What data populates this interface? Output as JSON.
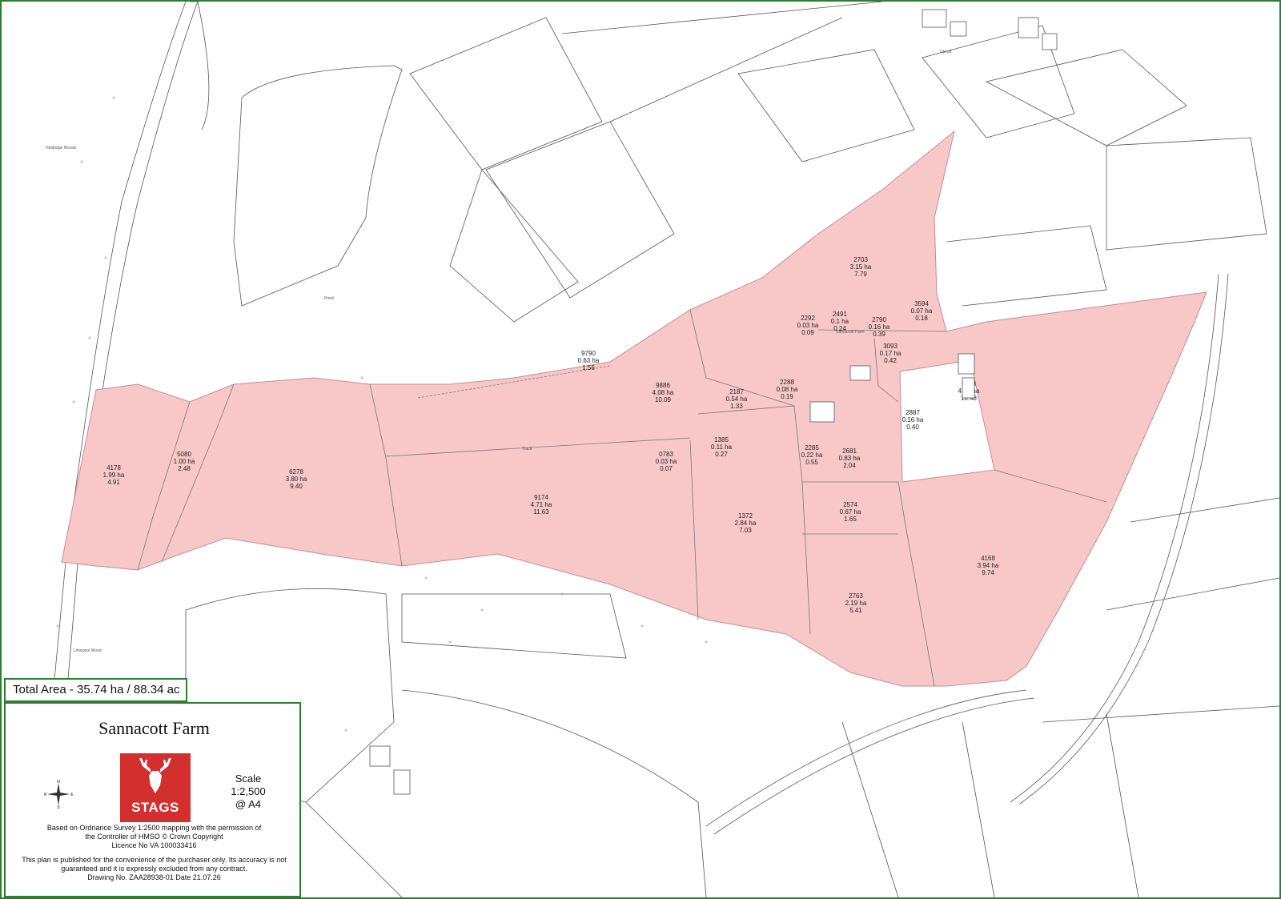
{
  "total_area": "Total Area - 35.74 ha / 88.34 ac",
  "legend": {
    "title": "Sannacott Farm",
    "logo_text": "STAGS",
    "scale": [
      "Scale",
      "1:2,500",
      "@ A4"
    ],
    "compass": {
      "n": "N",
      "s": "S",
      "e": "E",
      "w": "W"
    },
    "os_note": [
      "Based on Ordnance Survey 1:2500 mapping with the permission of",
      "the Controller of HMSO     © Crown Copyright",
      "Licence No VA 100033416"
    ],
    "disclaimer": [
      "This plan is published for the convenience of the purchaser only. Its accuracy is not",
      "guaranteed and it is expressly excluded from any contract.",
      "Drawing No. ZAA28938-01    Date 21.07.26"
    ]
  },
  "colors": {
    "parcel_fill": "#f8c8c8",
    "parcel_stroke": "#c98c8c",
    "frame": "#2e7d32",
    "logo": "#d32f2f"
  },
  "map_labels": {
    "holdridge_woods": "Holdridge Woods",
    "limepool_wood": "Limepool Wood",
    "sannacott_farm": "Sannacott Farm",
    "upcott": "Upcott",
    "pond": "Pond",
    "track": "Track"
  },
  "parcels": [
    {
      "id": "4178",
      "ha": "1.99 ha",
      "ac": "4.91"
    },
    {
      "id": "5080",
      "ha": "1.00 ha",
      "ac": "2.48"
    },
    {
      "id": "6278",
      "ha": "3.80 ha",
      "ac": "9.40"
    },
    {
      "id": "9174",
      "ha": "4.71 ha",
      "ac": "11.63"
    },
    {
      "id": "9790",
      "ha": "0.63 ha",
      "ac": "1.56"
    },
    {
      "id": "9886",
      "ha": "4.08 ha",
      "ac": "10.09"
    },
    {
      "id": "0783",
      "ha": "0.03 ha",
      "ac": "0.07"
    },
    {
      "id": "1385",
      "ha": "0.11 ha",
      "ac": "0.27"
    },
    {
      "id": "2187",
      "ha": "0.54 ha",
      "ac": "1.33"
    },
    {
      "id": "1372",
      "ha": "2.84 ha",
      "ac": "7.03"
    },
    {
      "id": "2288",
      "ha": "0.08 ha",
      "ac": "0.19"
    },
    {
      "id": "2292",
      "ha": "0.03 ha",
      "ac": "0.09"
    },
    {
      "id": "2491",
      "ha": "0.1 ha",
      "ac": "0.24"
    },
    {
      "id": "2790",
      "ha": "0.16 ha",
      "ac": "0.39"
    },
    {
      "id": "3093",
      "ha": "0.17 ha",
      "ac": "0.42"
    },
    {
      "id": "3594",
      "ha": "0.07 ha",
      "ac": "0.18"
    },
    {
      "id": "2703",
      "ha": "3.15 ha",
      "ac": "7.79"
    },
    {
      "id": "2887",
      "ha": "0.16 ha",
      "ac": "0.40"
    },
    {
      "id": "2285",
      "ha": "0.22 ha",
      "ac": "0.55"
    },
    {
      "id": "2681",
      "ha": "0.83 ha",
      "ac": "2.04"
    },
    {
      "id": "2574",
      "ha": "0.67 ha",
      "ac": "1.65"
    },
    {
      "id": "2763",
      "ha": "2.19 ha",
      "ac": "5.41"
    },
    {
      "id": "4168",
      "ha": "3.94 ha",
      "ac": "9.74"
    },
    {
      "id": "5388",
      "ha": "4.24 ha",
      "ac": "10.48"
    }
  ]
}
